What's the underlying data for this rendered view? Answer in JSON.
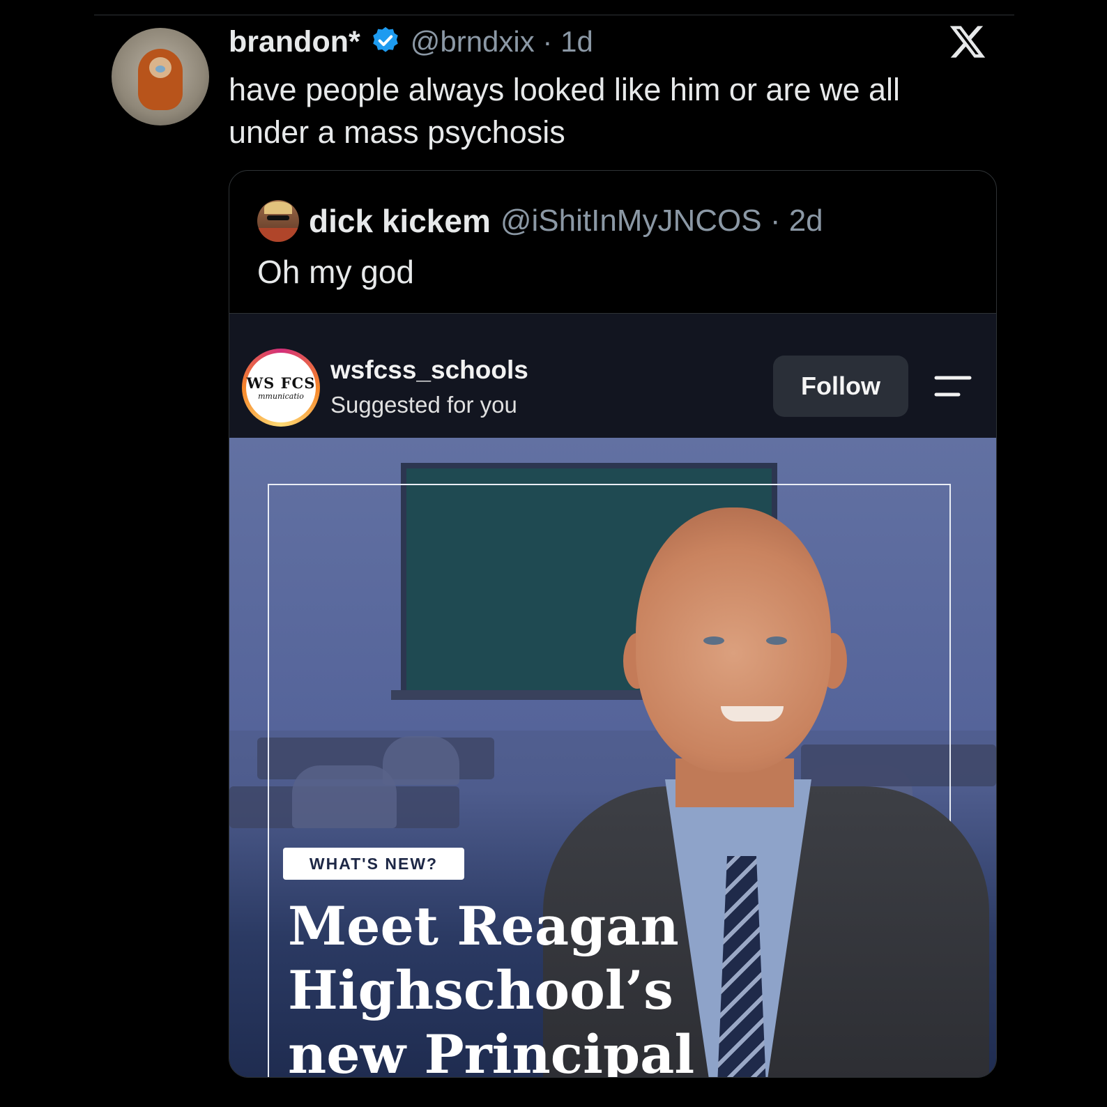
{
  "tweet": {
    "author_name": "brandon*",
    "handle": "@brndxix",
    "separator": "·",
    "age": "1d",
    "text": "have people always looked like him or are we all under a mass psychosis"
  },
  "quoted_tweet": {
    "author_name": "dick kickem",
    "handle": "@iShitInMyJNCOS",
    "separator": "·",
    "age": "2d",
    "text": "Oh my god"
  },
  "instagram_post": {
    "username": "wsfcss_schools",
    "subtitle": "Suggested for you",
    "follow_label": "Follow",
    "avatar_logo_text": "WS FCS",
    "avatar_logo_subtext": "mmunicatio",
    "badge": "WHAT'S NEW?",
    "headline_line1": "Meet Reagan",
    "headline_line2": "Highschool’s",
    "headline_line3": "new Principal"
  },
  "colors": {
    "background": "#000000",
    "verified_blue": "#1d9bf0",
    "muted_text": "#8b98a5",
    "follow_button_bg": "#2a2f38"
  },
  "icons": {
    "verified": "verified-badge-icon",
    "platform": "x-logo-icon",
    "menu": "menu-icon"
  }
}
